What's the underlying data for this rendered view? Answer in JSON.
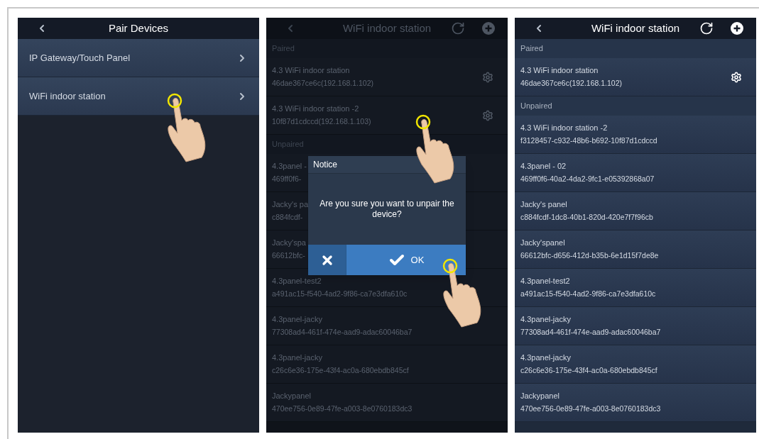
{
  "screens": [
    {
      "kind": "menu",
      "title": "Pair Devices",
      "dimmed": false,
      "items": [
        {
          "label": "IP Gateway/Touch Panel"
        },
        {
          "label": "WiFi indoor station"
        }
      ]
    },
    {
      "kind": "device_list",
      "title": "WiFi indoor station",
      "dimmed": true,
      "sections": [
        {
          "heading": "Paired",
          "devices": [
            {
              "name": "4.3 WiFi indoor station",
              "id": "46dae367ce6c(192.168.1.102)",
              "settings": true
            },
            {
              "name": "4.3 WiFi indoor station -2",
              "id": "10f87d1cdccd(192.168.1.103)",
              "settings": true
            }
          ]
        },
        {
          "heading": "Unpaired",
          "devices": [
            {
              "name": "4.3panel -",
              "id": "469ff0f6-",
              "settings": false
            },
            {
              "name": "Jacky's pa",
              "id": "c884fcdf-",
              "settings": false
            },
            {
              "name": "Jacky'spa",
              "id": "66612bfc-",
              "settings": false
            },
            {
              "name": "4.3panel-test2",
              "id": "a491ac15-f540-4ad2-9f86-ca7e3dfa610c",
              "settings": false
            },
            {
              "name": "4.3panel-jacky",
              "id": "77308ad4-461f-474e-aad9-adac60046ba7",
              "settings": false
            },
            {
              "name": "4.3panel-jacky",
              "id": "c26c6e36-175e-43f4-ac0a-680ebdb845cf",
              "settings": false
            },
            {
              "name": "Jackypanel",
              "id": "470ee756-0e89-47fe-a003-8e0760183dc3",
              "settings": false
            }
          ]
        }
      ],
      "dialog": {
        "title": "Notice",
        "message": "Are you sure you want to unpair the device?",
        "ok": "OK"
      }
    },
    {
      "kind": "device_list",
      "title": "WiFi indoor station",
      "dimmed": false,
      "sections": [
        {
          "heading": "Paired",
          "devices": [
            {
              "name": "4.3 WiFi indoor station",
              "id": "46dae367ce6c(192.168.1.102)",
              "settings": true
            }
          ]
        },
        {
          "heading": "Unpaired",
          "devices": [
            {
              "name": "4.3 WiFi indoor station -2",
              "id": "f3128457-c932-48b6-b692-10f87d1cdccd",
              "settings": false
            },
            {
              "name": "4.3panel - 02",
              "id": "469ff0f6-40a2-4da2-9fc1-e05392868a07",
              "settings": false
            },
            {
              "name": "Jacky's panel",
              "id": "c884fcdf-1dc8-40b1-820d-420e7f7f96cb",
              "settings": false
            },
            {
              "name": "Jacky'spanel",
              "id": "66612bfc-d656-412d-b35b-6e1d15f7de8e",
              "settings": false
            },
            {
              "name": "4.3panel-test2",
              "id": "a491ac15-f540-4ad2-9f86-ca7e3dfa610c",
              "settings": false
            },
            {
              "name": "4.3panel-jacky",
              "id": "77308ad4-461f-474e-aad9-adac60046ba7",
              "settings": false
            },
            {
              "name": "4.3panel-jacky",
              "id": "c26c6e36-175e-43f4-ac0a-680ebdb845cf",
              "settings": false
            },
            {
              "name": "Jackypanel",
              "id": "470ee756-0e89-47fe-a003-8e0760183dc3",
              "settings": false
            }
          ]
        }
      ]
    }
  ]
}
